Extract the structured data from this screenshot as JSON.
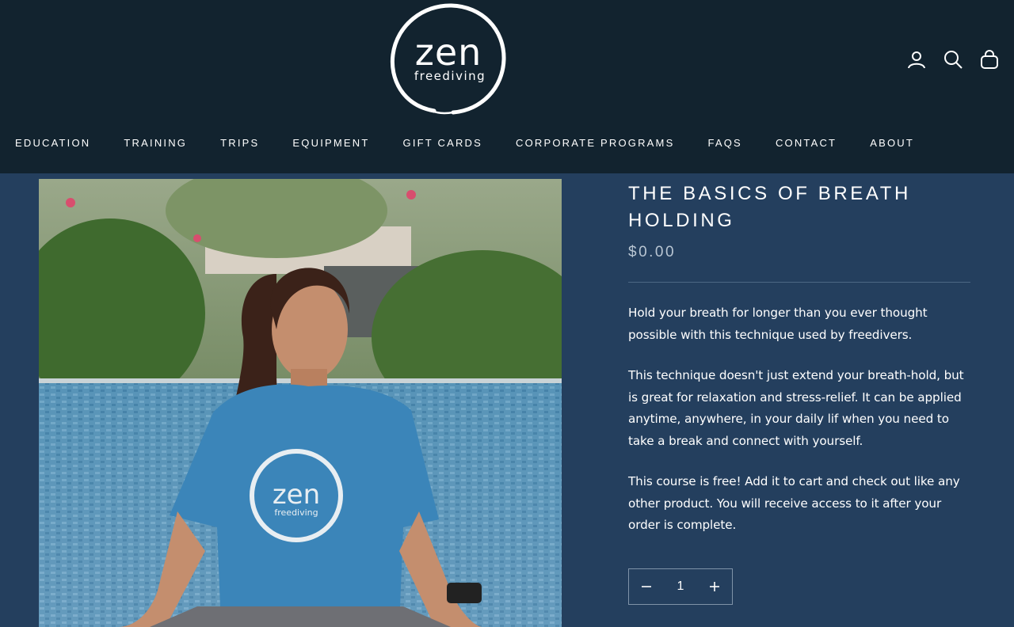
{
  "brand": {
    "logo_word": "zen",
    "logo_sub": "freediving"
  },
  "header_icons": [
    "account-icon",
    "search-icon",
    "shopping-bag-icon"
  ],
  "nav": [
    "EDUCATION",
    "TRAINING",
    "TRIPS",
    "EQUIPMENT",
    "GIFT CARDS",
    "CORPORATE PROGRAMS",
    "FAQS",
    "CONTACT",
    "ABOUT"
  ],
  "hero": {
    "shirt_word": "zen",
    "shirt_sub": "freediving"
  },
  "product": {
    "title": "THE BASICS OF BREATH HOLDING",
    "price": "$0.00",
    "paragraphs": [
      "Hold your breath for longer than you ever thought possible with this technique used by freedivers.",
      "This technique doesn't just extend your breath-hold, but is great for relaxation and stress-relief. It can be applied anytime, anywhere, in your daily lif when you need to take a break and connect with yourself.",
      "This course is free! Add it to cart and check out like any other product. You will receive access to it after your order is complete."
    ],
    "quantity": "1"
  },
  "colors": {
    "header_bg": "#12232f",
    "page_bg": "#243f5e",
    "price": "#b9c6d3"
  }
}
